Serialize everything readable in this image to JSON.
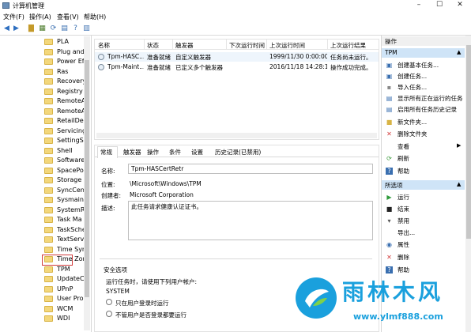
{
  "window": {
    "title": "计算机管理"
  },
  "menu": [
    "文件(F)",
    "操作(A)",
    "查看(V)",
    "帮助(H)"
  ],
  "tree": {
    "items": [
      "PLA",
      "Plug and",
      "Power Ef",
      "Ras",
      "Recovery",
      "Registry",
      "RemoteA",
      "RemoteA",
      "RetailDer",
      "Servicing",
      "SettingSy",
      "Shell",
      "Software",
      "SpacePo",
      "Storage",
      "SyncCent",
      "Sysmain",
      "SystemR",
      "Task Ma",
      "TaskSche",
      "TextServi",
      "Time Syn",
      "Time Zor",
      "TPM",
      "UpdateC",
      "UPnP",
      "User Pro",
      "WCM",
      "WDI"
    ]
  },
  "tasklist": {
    "columns": [
      "名称",
      "状态",
      "触发器",
      "下次运行时间",
      "上次运行时间",
      "上次运行结果"
    ],
    "rows": [
      [
        "Tpm-HASC...",
        "准备就绪",
        "自定义触发器",
        "",
        "1999/11/30 0:00:00",
        "任务尚未运行。"
      ],
      [
        "Tpm-Maint...",
        "准备就绪",
        "已定义多个触发器",
        "",
        "2016/11/18 14:28:19",
        "操作成功完成。"
      ]
    ]
  },
  "details": {
    "tabs": [
      "常规",
      "触发器",
      "操作",
      "条件",
      "设置",
      "历史记录(已禁用)"
    ],
    "name_label": "名称:",
    "name_value": "Tpm-HASCertRetr",
    "location_label": "位置:",
    "location_value": "\\Microsoft\\Windows\\TPM",
    "author_label": "创建者:",
    "author_value": "Microsoft Corporation",
    "desc_label": "描述:",
    "desc_value": "此任务请求健康认证证书。",
    "security_title": "安全选项",
    "run_as_label": "运行任务时，请使用下列用户帐户:",
    "account": "SYSTEM",
    "radio_logged_on": "只在用户登录时运行",
    "radio_any": "不管用户是否登录都要运行"
  },
  "actions": {
    "header": "操作",
    "section1": "TPM",
    "items1": [
      {
        "icon": "create-basic-task-icon",
        "label": "创建基本任务..."
      },
      {
        "icon": "create-task-icon",
        "label": "创建任务..."
      },
      {
        "icon": "import-icon",
        "label": "导入任务..."
      },
      {
        "icon": "show-running-icon",
        "label": "显示所有正在运行的任务"
      },
      {
        "icon": "enable-history-icon",
        "label": "启用所有任务历史记录"
      },
      {
        "icon": "new-folder-icon",
        "label": "新文件夹..."
      },
      {
        "icon": "delete-folder-icon",
        "label": "删除文件夹"
      },
      {
        "icon": "view-icon",
        "label": "查看"
      },
      {
        "icon": "refresh-icon",
        "label": "刷新"
      },
      {
        "icon": "help-icon",
        "label": "帮助"
      }
    ],
    "section2": "所选项",
    "items2": [
      {
        "icon": "run-icon",
        "label": "运行"
      },
      {
        "icon": "end-icon",
        "label": "结束"
      },
      {
        "icon": "disable-icon",
        "label": "禁用"
      },
      {
        "icon": "export-icon",
        "label": "导出..."
      },
      {
        "icon": "properties-icon",
        "label": "属性"
      },
      {
        "icon": "delete-icon",
        "label": "删除"
      },
      {
        "icon": "help-icon",
        "label": "帮助"
      }
    ]
  },
  "watermark": {
    "title": "雨林木风",
    "url": "www.ylmf888.com"
  },
  "colors": {
    "accent": "#1aa0dd",
    "highlight_box": "#d23b3b",
    "selected_section": "#cfe4f7"
  }
}
